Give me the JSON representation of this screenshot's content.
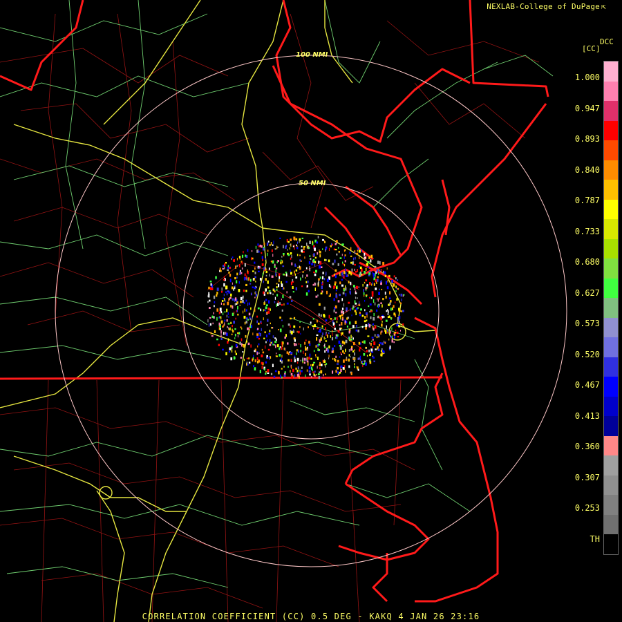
{
  "credit": "NEXLAB-College of DuPage",
  "credit_icon": "external-link-icon",
  "legend": {
    "title_right": "DCC",
    "title_left": "[CC]",
    "ticks": [
      "1.000",
      "0.947",
      "0.893",
      "0.840",
      "0.787",
      "0.733",
      "0.680",
      "0.627",
      "0.573",
      "0.520",
      "0.467",
      "0.413",
      "0.360",
      "0.307",
      "0.253",
      "TH"
    ],
    "colors": [
      "#ffb0d0",
      "#ff80b0",
      "#e0306a",
      "#ff0000",
      "#ff4a00",
      "#ff8c00",
      "#ffc000",
      "#ffff00",
      "#d8e800",
      "#a8e000",
      "#80e040",
      "#40ff40",
      "#80c080",
      "#9090d0",
      "#7070e0",
      "#3030e0",
      "#0000ff",
      "#0000cc",
      "#000099",
      "#ff8888",
      "#a0a0a0",
      "#909090",
      "#808080",
      "#707070",
      "#000000"
    ]
  },
  "rings": [
    {
      "label": "100 NMI"
    },
    {
      "label": "50 NMI"
    }
  ],
  "caption": "CORRELATION COEFFICIENT (CC) 0.5 DEG - KAKQ 4 JAN 26 23:16",
  "colors": {
    "state_border": "#ff1a1a",
    "county_line": "#cc2020",
    "road": "#78d878",
    "interstate": "#e8e840",
    "range_ring": "#ffc8c8",
    "text": "#ffff66"
  }
}
